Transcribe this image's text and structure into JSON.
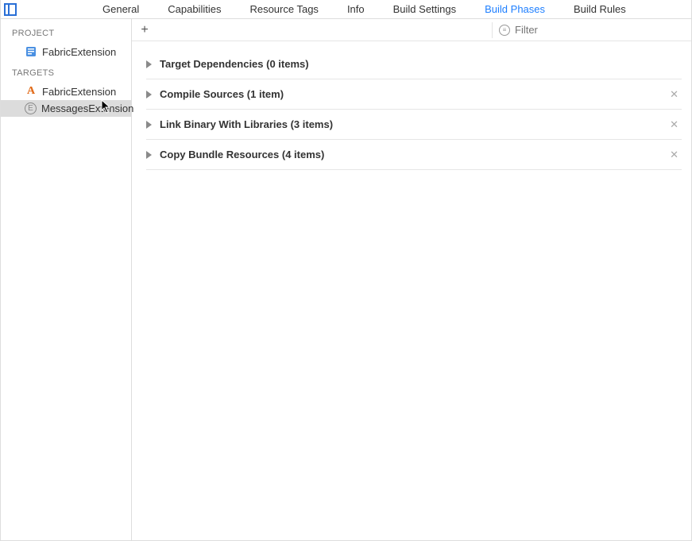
{
  "tabs": [
    {
      "label": "General"
    },
    {
      "label": "Capabilities"
    },
    {
      "label": "Resource Tags"
    },
    {
      "label": "Info"
    },
    {
      "label": "Build Settings"
    },
    {
      "label": "Build Phases",
      "active": true
    },
    {
      "label": "Build Rules"
    }
  ],
  "sidebar": {
    "projectHeader": "PROJECT",
    "project": "FabricExtension",
    "targetsHeader": "TARGETS",
    "targets": [
      {
        "name": "FabricExtension",
        "iconType": "app"
      },
      {
        "name": "MessagesExtension",
        "iconType": "ext",
        "selected": true
      }
    ]
  },
  "toolbar": {
    "filterPlaceholder": "Filter"
  },
  "phases": [
    {
      "title": "Target Dependencies (0 items)",
      "closable": false
    },
    {
      "title": "Compile Sources (1 item)",
      "closable": true
    },
    {
      "title": "Link Binary With Libraries (3 items)",
      "closable": true
    },
    {
      "title": "Copy Bundle Resources (4 items)",
      "closable": true
    }
  ]
}
